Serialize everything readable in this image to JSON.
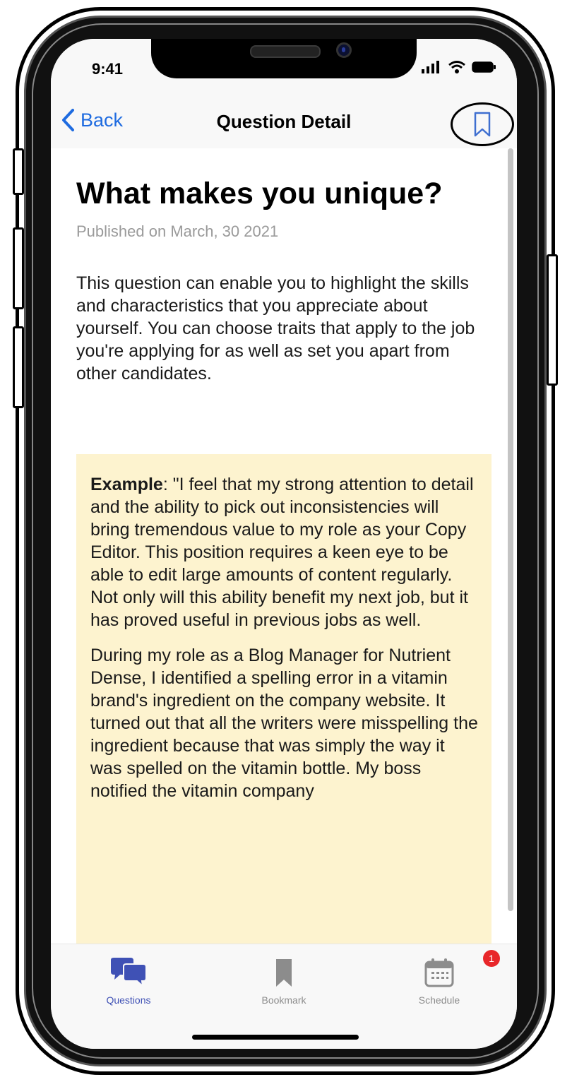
{
  "status_bar": {
    "time": "9:41",
    "icons": [
      "signal-icon",
      "wifi-icon",
      "battery-icon"
    ]
  },
  "nav": {
    "back_label": "Back",
    "title": "Question Detail",
    "action_icon": "bookmark-icon"
  },
  "question": {
    "title": "What makes you unique?",
    "published": "Published on March, 30 2021",
    "intro": "This question can enable you to highlight the skills and characteristics that you appreciate about yourself. You can choose traits that apply to the job you're applying for as well as set you apart from other candidates.",
    "example": {
      "label": "Example",
      "paragraph1": ": \"I feel that my strong attention to detail and the ability to pick out inconsistencies will bring tremendous value to my role as your Copy Editor. This position requires a keen eye to be able to edit large amounts of content regularly. Not only will this ability benefit my next job, but it has proved useful in previous jobs as well.",
      "paragraph2": "During my role as a Blog Manager for Nutrient Dense, I identified a spelling error in a vitamin brand's ingredient on the company website. It turned out that all the writers were misspelling the ingredient because that was simply the way it was spelled on the vitamin bottle. My boss notified the vitamin company"
    }
  },
  "tab_bar": {
    "tabs": [
      {
        "label": "Questions",
        "icon": "chat-bubbles-icon",
        "active": true
      },
      {
        "label": "Bookmark",
        "icon": "bookmark-icon",
        "active": false
      },
      {
        "label": "Schedule",
        "icon": "calendar-icon",
        "active": false,
        "badge": "1"
      }
    ]
  },
  "colors": {
    "accent": "#3f51b5",
    "link": "#1e6be0",
    "example_background": "#fdf3cf",
    "badge": "#e8272a"
  }
}
